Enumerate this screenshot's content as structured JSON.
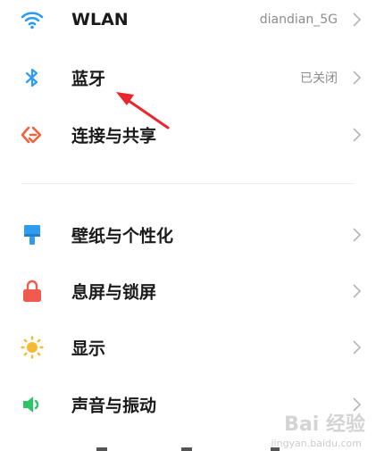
{
  "settings": {
    "items": [
      {
        "label": "WLAN",
        "value": "diandian_5G",
        "icon": "wifi-icon"
      },
      {
        "label": "蓝牙",
        "value": "已关闭",
        "icon": "bluetooth-icon"
      },
      {
        "label": "连接与共享",
        "value": "",
        "icon": "connection-share-icon"
      },
      {
        "label": "壁纸与个性化",
        "value": "",
        "icon": "wallpaper-icon"
      },
      {
        "label": "息屏与锁屏",
        "value": "",
        "icon": "lock-icon"
      },
      {
        "label": "显示",
        "value": "",
        "icon": "sun-icon"
      },
      {
        "label": "声音与振动",
        "value": "",
        "icon": "speaker-icon"
      }
    ]
  },
  "watermark": {
    "text": "Bai 经验",
    "url": "jingyan.baidu.com"
  },
  "colors": {
    "wifi": "#2d9cf0",
    "bluetooth": "#2d9cf0",
    "connection": "#f0633c",
    "wallpaper": "#2d9cf0",
    "lock": "#f05a4f",
    "display": "#f5b933",
    "sound": "#2ec46a",
    "annotation_arrow": "#e8262c"
  }
}
